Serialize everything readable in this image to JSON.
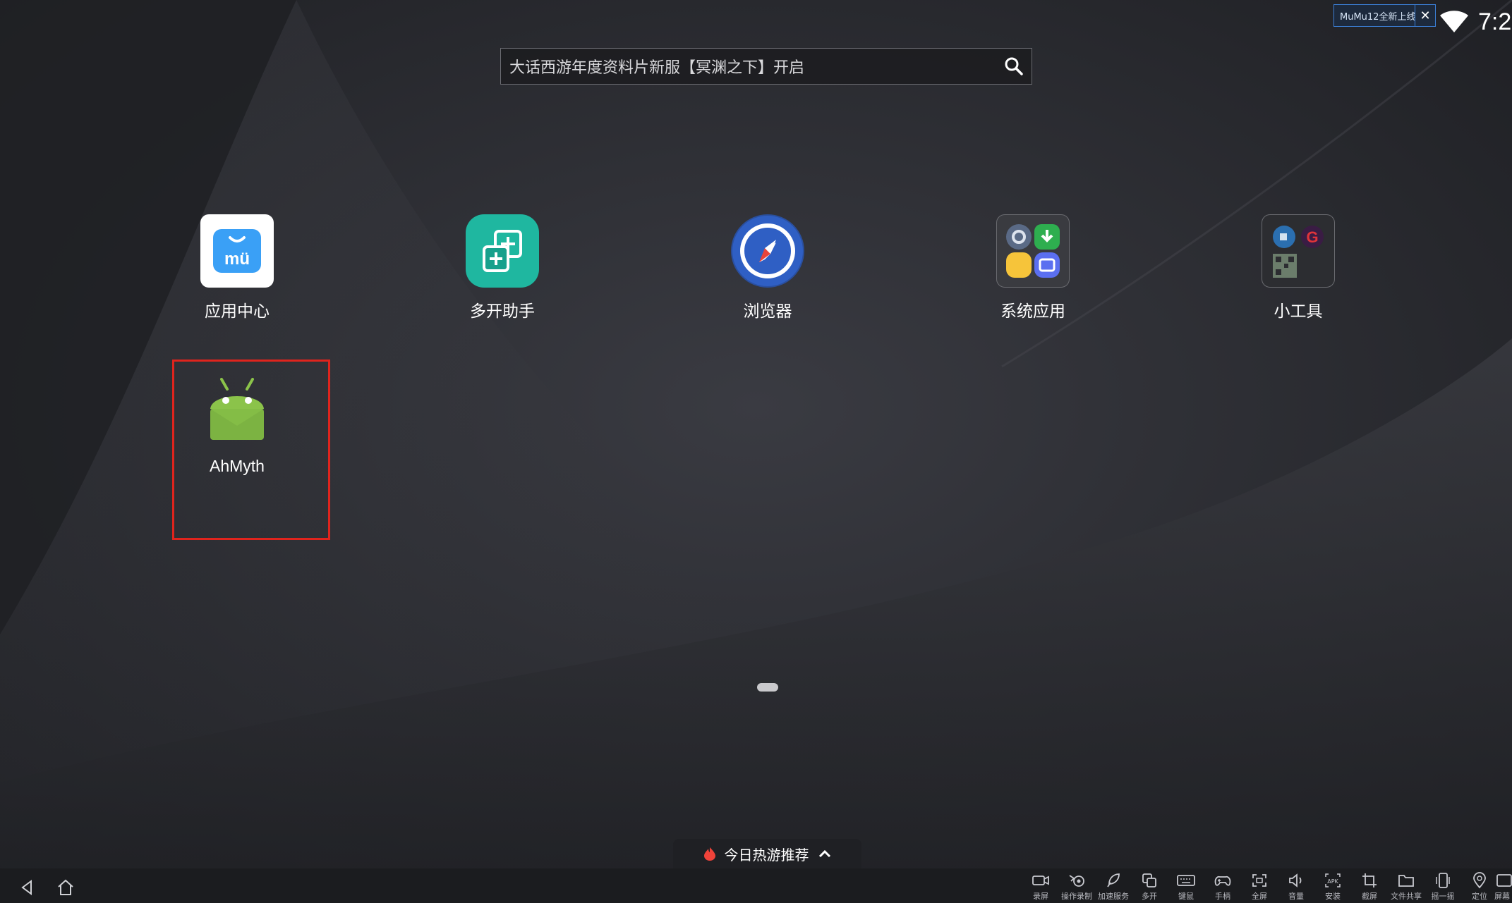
{
  "status": {
    "notice": "MuMu12全新上线",
    "clock": "7:2"
  },
  "search": {
    "placeholder": "大话西游年度资料片新服【冥渊之下】开启"
  },
  "apps": [
    {
      "label": "应用中心",
      "icon": "app-center-icon",
      "color": "#3aa0f6"
    },
    {
      "label": "多开助手",
      "icon": "multi-open-icon",
      "color": "#1fb7a0"
    },
    {
      "label": "浏览器",
      "icon": "browser-compass-icon",
      "color": "#2f5fc4"
    },
    {
      "label": "系统应用",
      "icon": "system-apps-folder-icon",
      "color": "#3a3b40"
    },
    {
      "label": "小工具",
      "icon": "tools-folder-icon",
      "color": "#2c2d31"
    },
    {
      "label": "AhMyth",
      "icon": "android-icon",
      "color": "#8bc34a"
    }
  ],
  "hot_games": {
    "label": "今日热游推荐"
  },
  "toolbar": [
    {
      "label": "录屏",
      "icon": "record-icon"
    },
    {
      "label": "操作录制",
      "icon": "macro-record-icon"
    },
    {
      "label": "加速服务",
      "icon": "rocket-icon"
    },
    {
      "label": "多开",
      "icon": "multi-window-icon"
    },
    {
      "label": "键鼠",
      "icon": "keyboard-icon"
    },
    {
      "label": "手柄",
      "icon": "gamepad-icon"
    },
    {
      "label": "全屏",
      "icon": "fullscreen-icon"
    },
    {
      "label": "音量",
      "icon": "volume-icon"
    },
    {
      "label": "安装",
      "icon": "apk-install-icon"
    },
    {
      "label": "截屏",
      "icon": "crop-icon"
    },
    {
      "label": "文件共享",
      "icon": "folder-icon"
    },
    {
      "label": "摇一摇",
      "icon": "shake-icon"
    },
    {
      "label": "定位",
      "icon": "location-icon"
    },
    {
      "label": "屏幕",
      "icon": "screen-icon"
    }
  ],
  "colors": {
    "highlight": "#e0241d",
    "background": "#232428"
  }
}
